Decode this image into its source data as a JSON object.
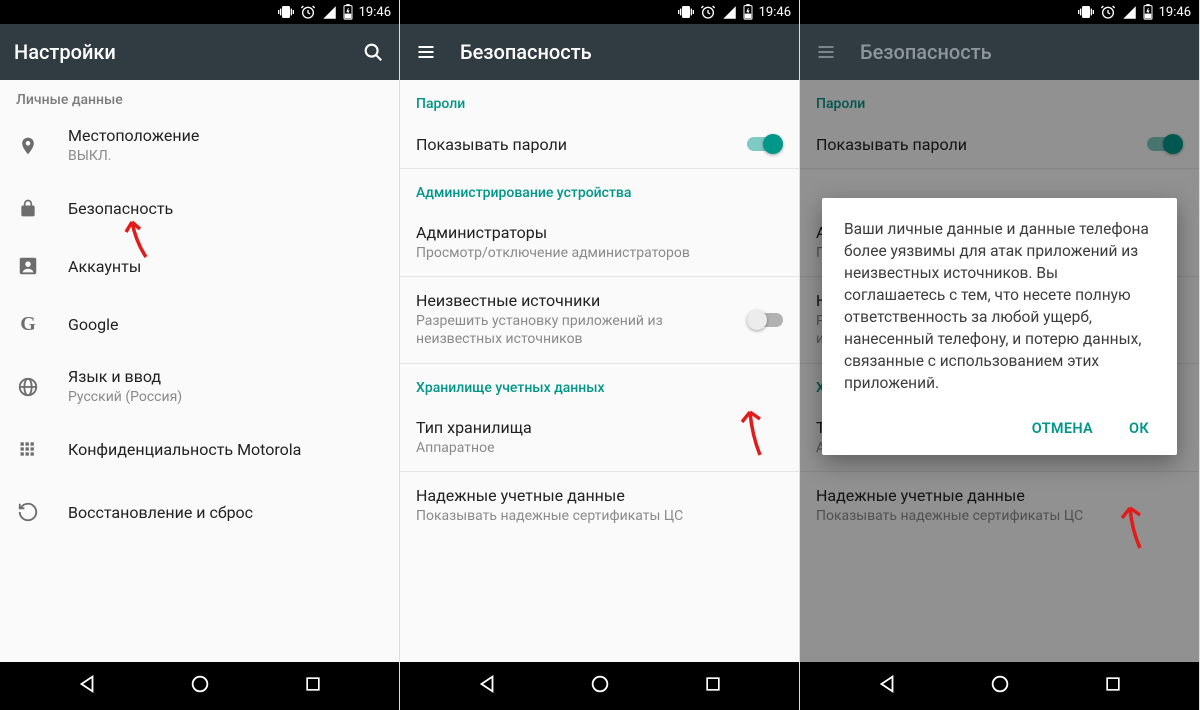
{
  "status": {
    "time": "19:46"
  },
  "colors": {
    "teal": "#009688",
    "appbar": "#303c42",
    "annotation": "#e21b1b"
  },
  "screen1": {
    "title": "Настройки",
    "personalHeader": "Личные данные",
    "items": {
      "location": {
        "label": "Местоположение",
        "sub": "ВЫКЛ."
      },
      "security": {
        "label": "Безопасность"
      },
      "accounts": {
        "label": "Аккаунты"
      },
      "google": {
        "label": "Google"
      },
      "language": {
        "label": "Язык и ввод",
        "sub": "Русский (Россия)"
      },
      "privacy": {
        "label": "Конфиденциальность Motorola"
      },
      "backup": {
        "label": "Восстановление и сброс"
      }
    }
  },
  "screen2": {
    "title": "Безопасность",
    "headers": {
      "passwords": "Пароли",
      "admin": "Администрирование устройства",
      "creds": "Хранилище учетных данных"
    },
    "items": {
      "showPasswords": {
        "label": "Показывать пароли"
      },
      "admins": {
        "label": "Администраторы",
        "sub": "Просмотр/отключение администраторов"
      },
      "unknown": {
        "label": "Неизвестные источники",
        "sub": "Разрешить установку приложений из неизвестных источников"
      },
      "storageType": {
        "label": "Тип хранилища",
        "sub": "Аппаратное"
      },
      "trusted": {
        "label": "Надежные учетные данные",
        "sub": "Показывать надежные сертификаты ЦС"
      }
    }
  },
  "screen3": {
    "title": "Безопасность",
    "dialog": {
      "text": "Ваши личные данные и данные телефона более уязвимы для атак приложений из неизвестных источников. Вы соглашаетесь с тем, что несете полную ответственность за любой ущерб, нанесенный телефону, и потерю данных, связанные с использованием этих приложений.",
      "cancel": "ОТМЕНА",
      "ok": "ОК"
    }
  }
}
